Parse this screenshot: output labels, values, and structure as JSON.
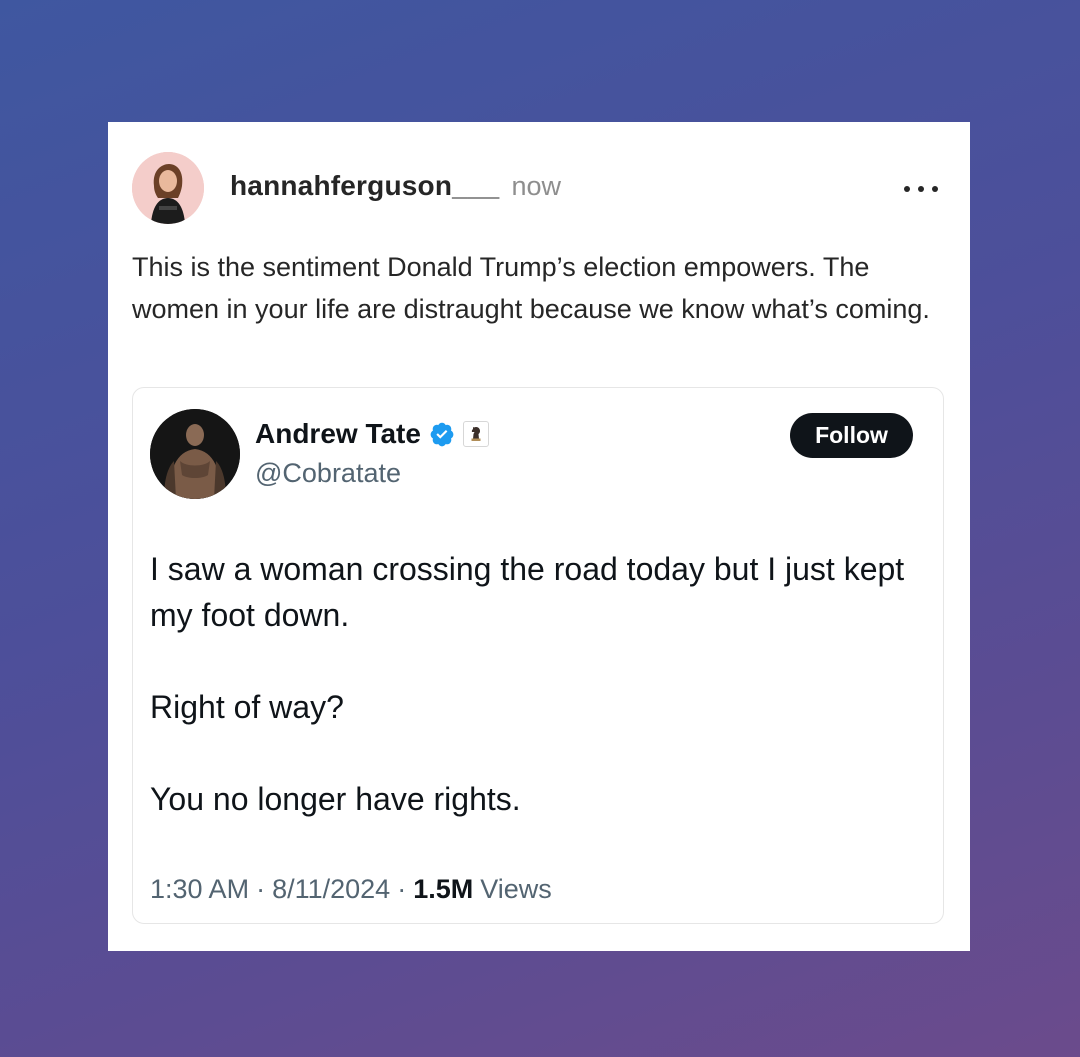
{
  "post": {
    "username": "hannahferguson___",
    "timestamp": "now",
    "text": "This is the sentiment Donald Trump’s election empowers. The women in your life are distraught because we know what’s coming."
  },
  "quoted_tweet": {
    "display_name": "Andrew Tate",
    "handle": "@Cobratate",
    "follow_label": "Follow",
    "body": {
      "line1": "I saw a woman crossing the road today but I just kept my foot down.",
      "line2": "Right of way?",
      "line3": "You no longer have rights."
    },
    "time": "1:30 AM",
    "date": "8/11/2024",
    "separator": "·",
    "views_count": "1.5M",
    "views_label": "Views"
  },
  "colors": {
    "verified_badge": "#1d9bf0",
    "follow_bg": "#0f1419"
  }
}
